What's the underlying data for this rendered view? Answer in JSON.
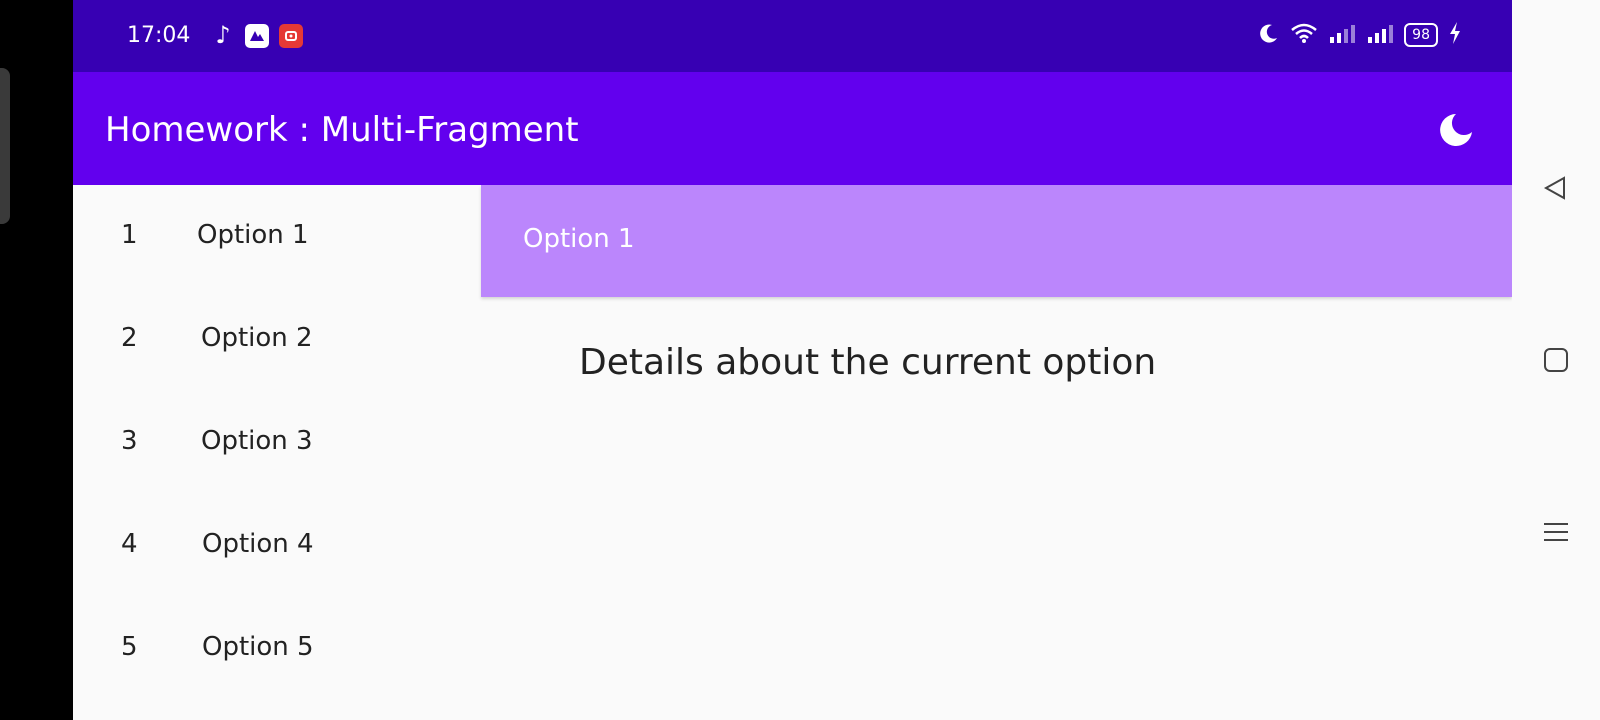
{
  "status_bar": {
    "time": "17:04",
    "left_icons": [
      "music-note-icon",
      "gallery-app-icon",
      "screen-recorder-icon"
    ],
    "right_icons": [
      "do-not-disturb-icon",
      "wifi-icon",
      "signal-1-icon",
      "signal-2-icon"
    ],
    "battery": "98",
    "charging": true
  },
  "toolbar": {
    "title": "Homework : Multi-Fragment",
    "action_icon": "night-mode-icon"
  },
  "list": {
    "items": [
      {
        "number": "1",
        "label": "Option 1"
      },
      {
        "number": "2",
        "label": "Option 2"
      },
      {
        "number": "3",
        "label": "Option 3"
      },
      {
        "number": "4",
        "label": "Option 4"
      },
      {
        "number": "5",
        "label": "Option 5"
      }
    ]
  },
  "detail": {
    "header": "Option 1",
    "text": "Details about the current option"
  },
  "nav": {
    "icons": [
      "back-icon",
      "home-icon",
      "menu-icon"
    ]
  },
  "colors": {
    "status_bar": "#3700b3",
    "toolbar": "#6200ee",
    "detail_header": "#bb86fc",
    "background": "#fafafa"
  }
}
